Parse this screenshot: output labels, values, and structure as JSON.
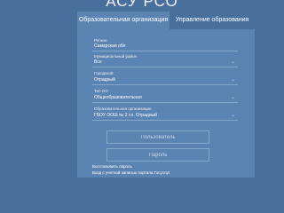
{
  "app": {
    "title": "АСУ РСО"
  },
  "tabs": [
    {
      "label": "Образовательная организация",
      "active": true
    },
    {
      "label": "Управление образования",
      "active": false
    }
  ],
  "form": {
    "fields": [
      {
        "label": "Регион",
        "value": "Самарская обл"
      },
      {
        "label": "Муниципальный район",
        "value": "Все"
      },
      {
        "label": "Городской",
        "value": "Отрадный"
      },
      {
        "label": "Тип ОО",
        "value": "Общеобразовательная"
      },
      {
        "label": "Образовательная организация",
        "value": "ГБОУ ООШ № 2 г.о. Отрадный"
      }
    ],
    "login_placeholder": "Пользователь",
    "password_placeholder": "Пароль",
    "restore_link": "Восстановить пароль",
    "gosuslugi_link": "Вход с учетной записью портала Госуслуг"
  },
  "colors": {
    "background": "#496f9d",
    "panel": "#5b84b3",
    "border": "#86a7cc"
  },
  "icons": {
    "dropdown": "chevron-down-icon"
  }
}
